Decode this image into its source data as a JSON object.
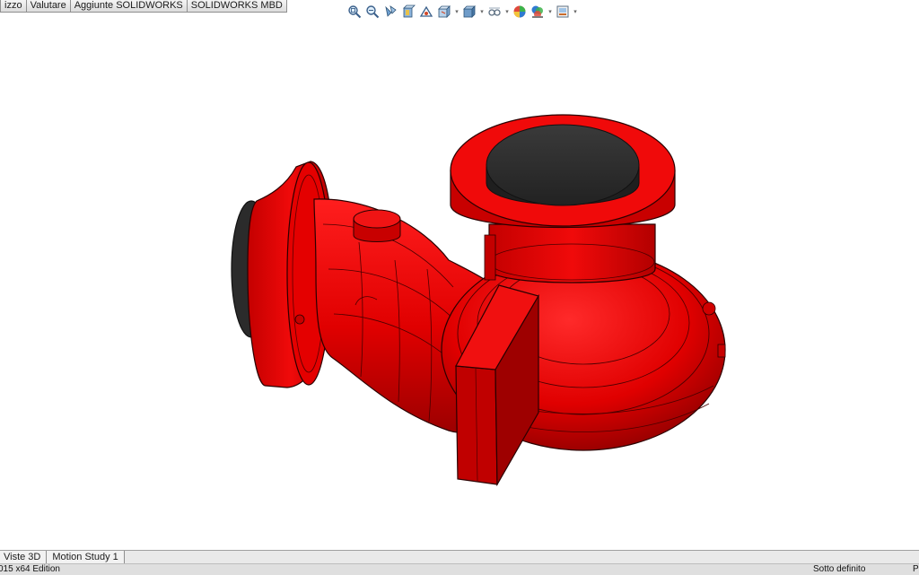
{
  "command_manager": {
    "tabs": [
      "izzo",
      "Valutare",
      "Aggiunte SOLIDWORKS",
      "SOLIDWORKS MBD"
    ]
  },
  "heads_up_toolbar": {
    "buttons": [
      {
        "icon": "zoom-to-fit-icon"
      },
      {
        "icon": "zoom-to-area-icon"
      },
      {
        "icon": "previous-view-icon"
      },
      {
        "icon": "section-view-icon"
      },
      {
        "icon": "dynamic-annotation-views-icon"
      },
      {
        "icon": "view-orientation-icon"
      },
      {
        "icon": "display-style-icon"
      },
      {
        "icon": "hide-show-items-icon"
      },
      {
        "icon": "edit-appearance-icon"
      },
      {
        "icon": "apply-scene-icon"
      },
      {
        "icon": "view-settings-icon"
      }
    ]
  },
  "model": {
    "name": "pump-housing",
    "colors": {
      "body": "#e00000",
      "body_dark": "#8c0000",
      "edge": "#2a0000",
      "cap": "#2e2e2e"
    }
  },
  "bottom_tabs": [
    "Viste 3D",
    "Motion Study 1"
  ],
  "status_bar": {
    "edition": "015 x64 Edition",
    "state": "Sotto definito",
    "trailing": "P"
  }
}
